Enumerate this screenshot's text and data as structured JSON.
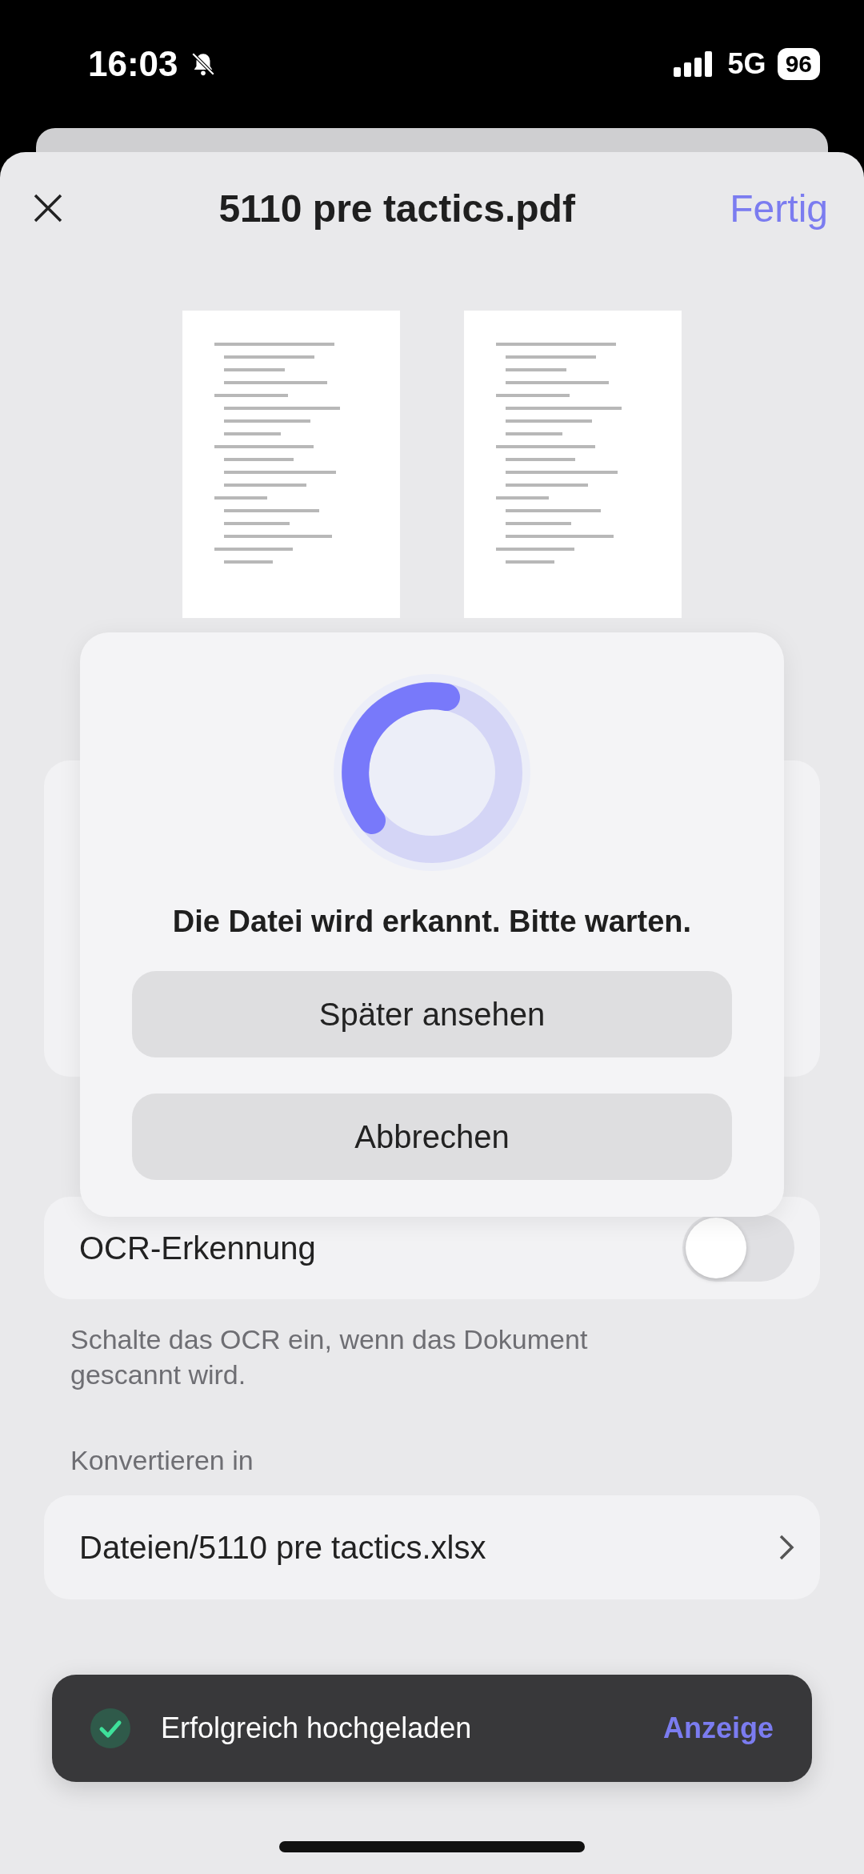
{
  "status_bar": {
    "time": "16:03",
    "network": "5G",
    "battery": "96"
  },
  "header": {
    "title": "5110 pre tactics.pdf",
    "done": "Fertig"
  },
  "pages": [
    {
      "kind": "page"
    },
    {
      "kind": "page"
    }
  ],
  "ocr": {
    "label": "OCR-Erkennung",
    "on": false,
    "hint": "Schalte das OCR ein, wenn das Dokument gescannt wird."
  },
  "convert": {
    "label": "Konvertieren in",
    "destination": "Dateien/5110 pre tactics.xlsx"
  },
  "dialog": {
    "message": "Die Datei wird erkannt. Bitte warten.",
    "buttons": [
      "Später ansehen",
      "Abbrechen"
    ]
  },
  "toast": {
    "message": "Erfolgreich hochgeladen",
    "action": "Anzeige"
  }
}
